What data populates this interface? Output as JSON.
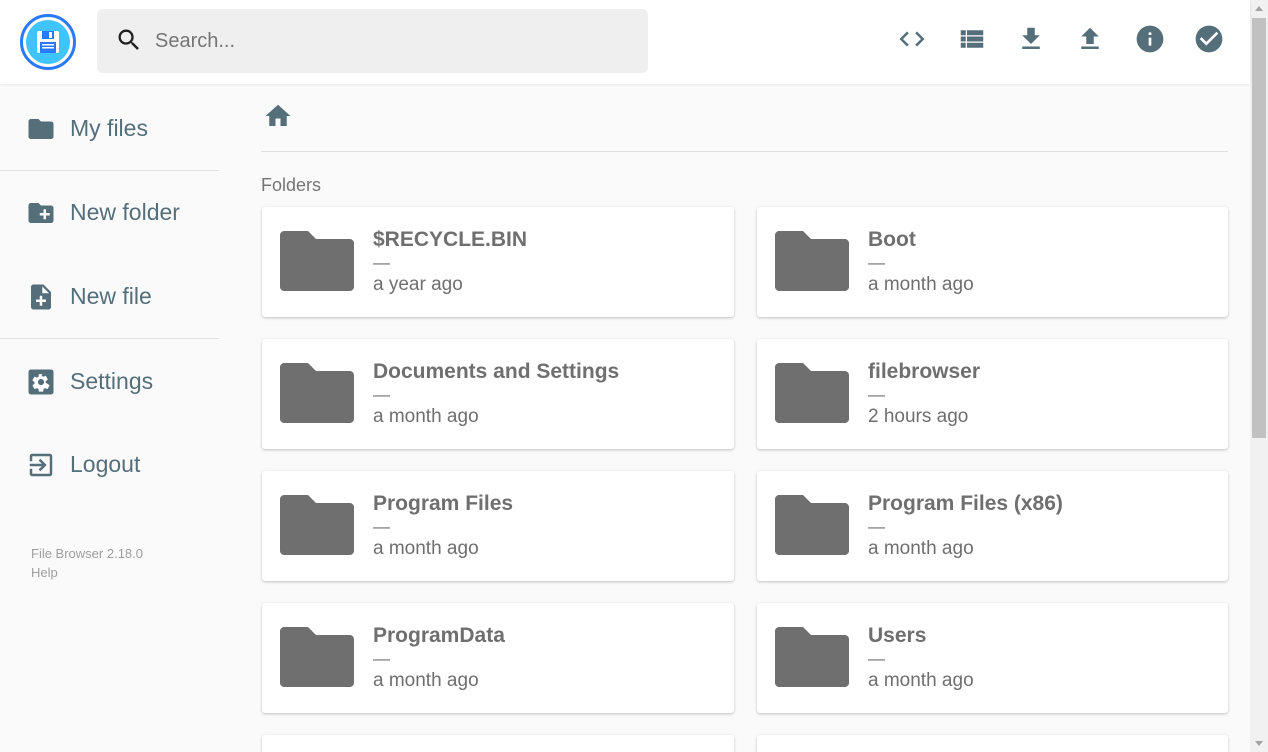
{
  "header": {
    "search_placeholder": "Search...",
    "actions": [
      {
        "name": "toggle-view-code-icon",
        "label": "code"
      },
      {
        "name": "list-view-icon",
        "label": "list"
      },
      {
        "name": "download-icon",
        "label": "download"
      },
      {
        "name": "upload-icon",
        "label": "upload"
      },
      {
        "name": "info-icon",
        "label": "info"
      },
      {
        "name": "select-multiple-icon",
        "label": "check"
      }
    ]
  },
  "sidebar": {
    "items": [
      {
        "label": "My files",
        "icon": "folder-icon"
      },
      {
        "label": "New folder",
        "icon": "create-new-folder-icon"
      },
      {
        "label": "New file",
        "icon": "note-add-icon"
      },
      {
        "label": "Settings",
        "icon": "settings-icon"
      },
      {
        "label": "Logout",
        "icon": "logout-icon"
      }
    ],
    "version": "File Browser 2.18.0",
    "help": "Help"
  },
  "main": {
    "breadcrumb_icon": "home-icon",
    "folders_title": "Folders",
    "folders": [
      {
        "name": "$RECYCLE.BIN",
        "size": "—",
        "modified": "a year ago"
      },
      {
        "name": "Boot",
        "size": "—",
        "modified": "a month ago"
      },
      {
        "name": "Documents and Settings",
        "size": "—",
        "modified": "a month ago"
      },
      {
        "name": "filebrowser",
        "size": "—",
        "modified": "2 hours ago"
      },
      {
        "name": "Program Files",
        "size": "—",
        "modified": "a month ago"
      },
      {
        "name": "Program Files (x86)",
        "size": "—",
        "modified": "a month ago"
      },
      {
        "name": "ProgramData",
        "size": "—",
        "modified": "a month ago"
      },
      {
        "name": "Users",
        "size": "—",
        "modified": "a month ago"
      },
      {
        "name": "",
        "size": "",
        "modified": ""
      },
      {
        "name": "",
        "size": "",
        "modified": ""
      }
    ]
  },
  "colors": {
    "accent": "#2979ff",
    "icon": "#546e7a",
    "folder": "#6f6f6f"
  }
}
